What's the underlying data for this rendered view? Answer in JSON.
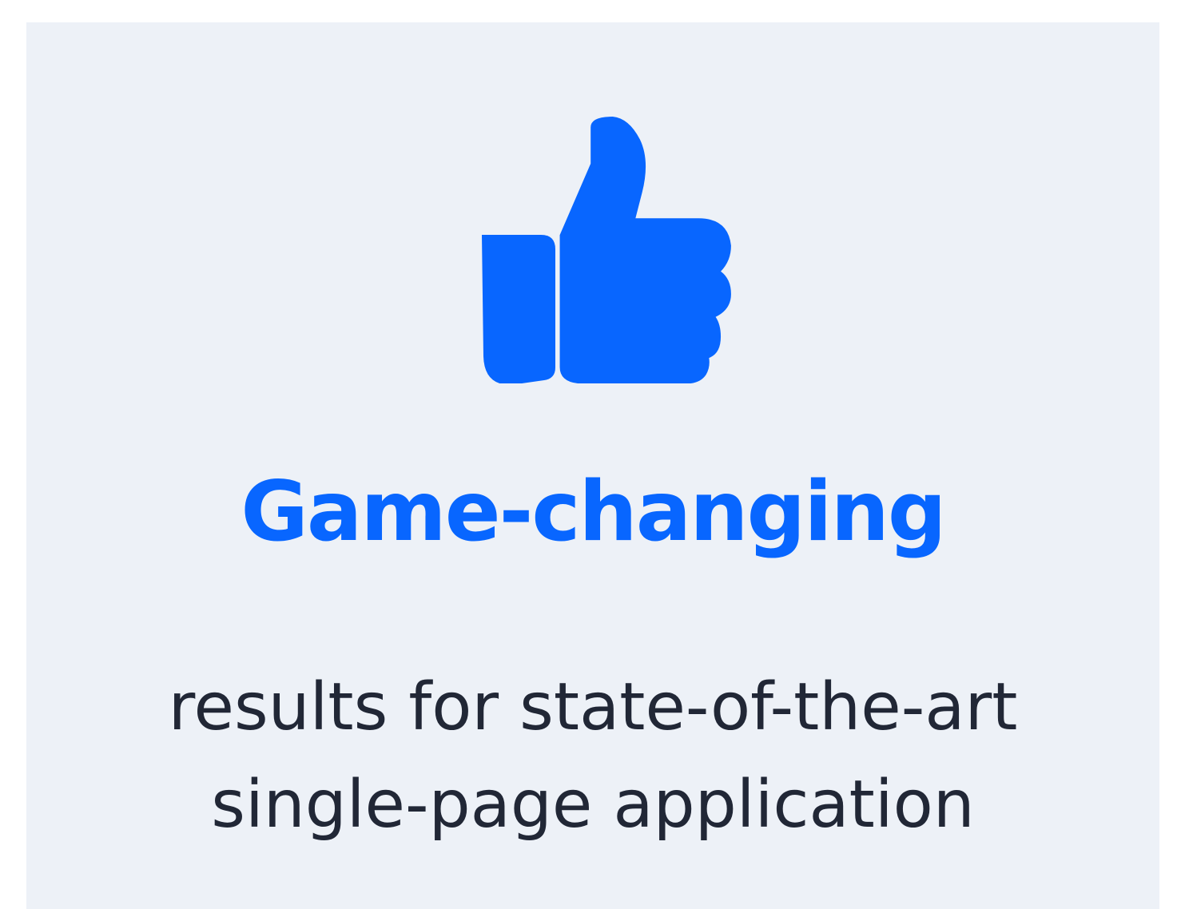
{
  "card": {
    "icon": "thumbs-up-icon",
    "title": "Game-changing",
    "subtitle_lines": [
      "results for state-of-the-art",
      "single-page application"
    ]
  },
  "colors": {
    "accent": "#0866ff",
    "background": "#edf1f7",
    "text": "#212736"
  }
}
